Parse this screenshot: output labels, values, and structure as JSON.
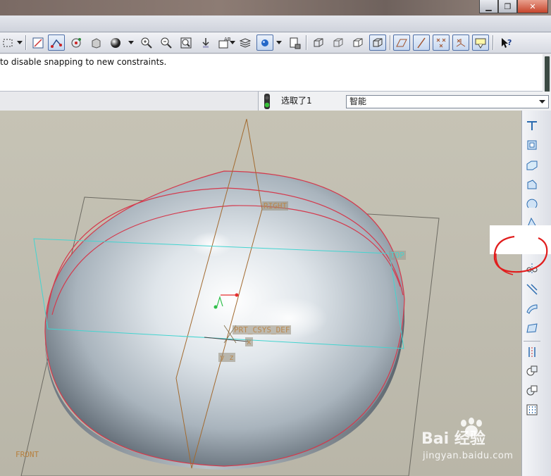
{
  "window": {
    "buttons": [
      {
        "name": "minimize",
        "glyph": "▁"
      },
      {
        "name": "maximize",
        "glyph": "❐"
      },
      {
        "name": "close",
        "glyph": "✕"
      }
    ]
  },
  "toolbar": {
    "buttons": [
      "select-box-icon",
      "redraw-icon",
      "snap-constraints-icon",
      "spin-center-icon",
      "orient-mode-icon",
      "shading-icon",
      "zoom-in-icon",
      "zoom-out-icon",
      "refit-icon",
      "reorient-icon",
      "saved-views-icon",
      "layers-icon",
      "appearance-icon",
      "model-display-icon",
      "wireframe-icon",
      "hidden-line-icon",
      "no-hidden-icon",
      "shaded-icon",
      "datum-planes-icon",
      "datum-axes-icon",
      "datum-points-icon",
      "csys-icon",
      "annotations-icon",
      "context-help-icon"
    ]
  },
  "message": {
    "text": "to disable snapping to new constraints."
  },
  "status": {
    "selected": "选取了1",
    "filter": "智能"
  },
  "datum_labels": {
    "right": "RIGHT",
    "top": "TOP",
    "csys": "PRT_CSYS_DEF",
    "x_axis": "x",
    "yz_axis": "y z",
    "front": "FRONT"
  },
  "right_toolbar": {
    "tools": [
      "sweep-icon",
      "shell-icon",
      "datum-plane-tool-icon",
      "rib-icon",
      "revolve-icon",
      "draft-icon",
      "mirror-icon",
      "merge-icon",
      "trim-icon",
      "extend-icon",
      "offset-icon",
      "thicken-icon",
      "solidify-icon",
      "round-icon",
      "chamfer-icon",
      "pattern-icon"
    ]
  },
  "watermark": {
    "brand": "Bai 经验",
    "url": "jingyan.baidu.com"
  },
  "colors": {
    "datum_plane": "#a26a2f",
    "top_plane": "#43d4d0",
    "edges": "#d43a4d",
    "annotation": "#e11d1d"
  }
}
